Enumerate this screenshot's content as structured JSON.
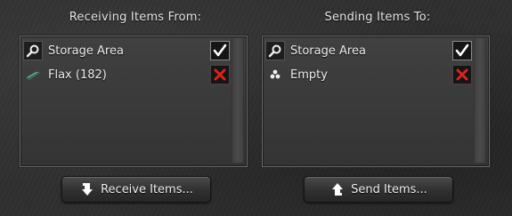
{
  "receiving": {
    "title": "Receiving Items From:",
    "rows": [
      {
        "label": "Storage Area",
        "icon": "magnifier-icon",
        "action": "checkmark"
      },
      {
        "label": "Flax (182)",
        "icon": "flax-icon",
        "action": "remove-x"
      }
    ],
    "button_label": "Receive Items..."
  },
  "sending": {
    "title": "Sending Items To:",
    "rows": [
      {
        "label": "Storage Area",
        "icon": "magnifier-icon",
        "action": "checkmark"
      },
      {
        "label": "Empty",
        "icon": "pile-icon",
        "action": "remove-x"
      }
    ],
    "button_label": "Send Items..."
  },
  "colors": {
    "remove_x": "#e0221b",
    "check": "#ffffff"
  }
}
